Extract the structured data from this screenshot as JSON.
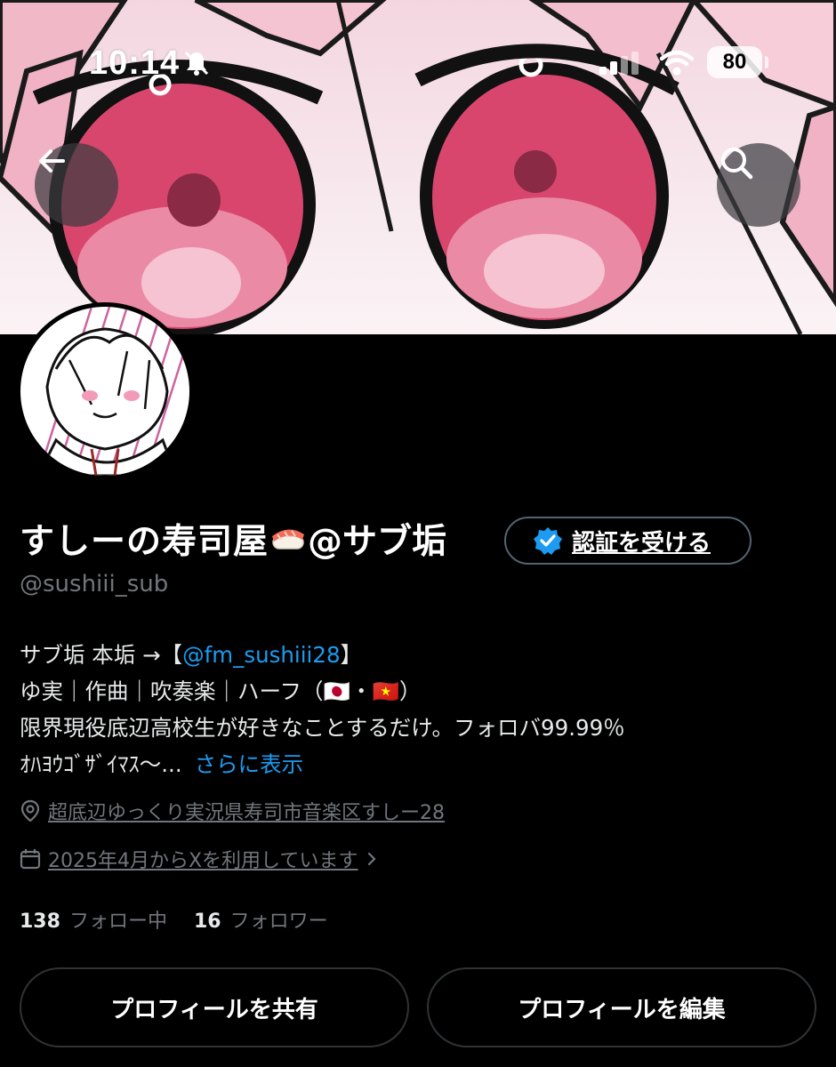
{
  "status_bar": {
    "time": "10:14",
    "battery": "80"
  },
  "header": {
    "back_icon": "arrow-left-icon",
    "search_icon": "search-icon"
  },
  "profile": {
    "name_prefix": "すしーの寿司屋",
    "name_suffix": "@サブ垢",
    "handle": "@sushiii_sub",
    "verify_label": "認証を受ける",
    "bio_line1_prefix": "サブ垢 本垢 →【",
    "bio_line1_link": "@fm_sushiii28",
    "bio_line1_suffix": "】",
    "bio_line2": "ゆ実｜作曲｜吹奏楽｜ハーフ（🇯🇵・🇻🇳）",
    "bio_line3": "限界現役底辺高校生が好きなことするだけ。フォロバ99.99％",
    "bio_line4": "ｵﾊﾖｳｺﾞｻﾞｲﾏｽ〜...",
    "show_more": "さらに表示",
    "location": "超底辺ゆっくり実況県寿司市音楽区すしー28",
    "joined": "2025年4月からXを利用しています",
    "following_count": "138",
    "following_label": "フォロー中",
    "followers_count": "16",
    "followers_label": "フォロワー"
  },
  "actions": {
    "share_label": "プロフィールを共有",
    "edit_label": "プロフィールを編集"
  },
  "colors": {
    "accent": "#1d9bf0",
    "background": "#000000",
    "muted": "#71767b"
  }
}
